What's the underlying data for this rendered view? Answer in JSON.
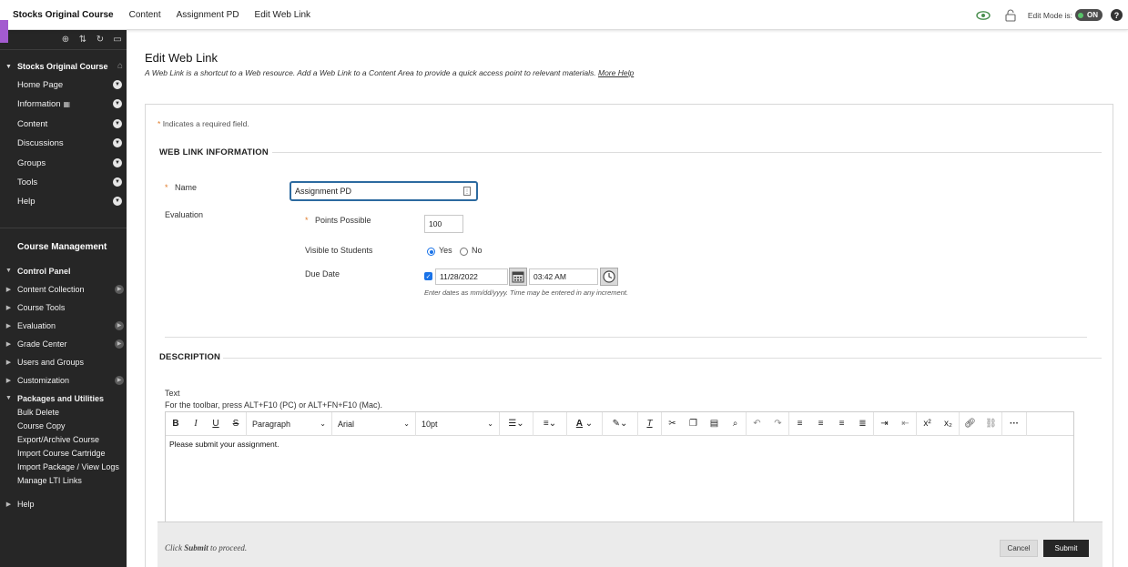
{
  "topbar": {
    "course": "Stocks Original Course",
    "breadcrumbs": [
      "Content",
      "Assignment PD",
      "Edit Web Link"
    ],
    "edit_mode_label": "Edit Mode is:",
    "edit_mode_state": "ON",
    "help": "?"
  },
  "sidebar": {
    "course_title": "Stocks Original Course",
    "items": [
      {
        "label": "Home Page"
      },
      {
        "label": "Information"
      },
      {
        "label": "Content"
      },
      {
        "label": "Discussions"
      },
      {
        "label": "Groups"
      },
      {
        "label": "Tools"
      },
      {
        "label": "Help"
      }
    ],
    "course_management": "Course Management",
    "control_panel": "Control Panel",
    "cp_items": [
      {
        "label": "Content Collection"
      },
      {
        "label": "Course Tools"
      },
      {
        "label": "Evaluation"
      },
      {
        "label": "Grade Center"
      },
      {
        "label": "Users and Groups"
      },
      {
        "label": "Customization"
      }
    ],
    "packages": "Packages and Utilities",
    "packages_items": [
      {
        "label": "Bulk Delete"
      },
      {
        "label": "Course Copy"
      },
      {
        "label": "Export/Archive Course"
      },
      {
        "label": "Import Course Cartridge"
      },
      {
        "label": "Import Package / View Logs"
      },
      {
        "label": "Manage LTI Links"
      }
    ],
    "help": "Help"
  },
  "page": {
    "title": "Edit Web Link",
    "description": "A Web Link is a shortcut to a Web resource. Add a Web Link to a Content Area to provide a quick access point to relevant materials.",
    "more_help": "More Help",
    "required_note": "Indicates a required field."
  },
  "form": {
    "section1": "WEB LINK INFORMATION",
    "name_label": "Name",
    "name_value": "Assignment PD",
    "evaluation_label": "Evaluation",
    "points_label": "Points Possible",
    "points_value": "100",
    "visible_label": "Visible to Students",
    "yes": "Yes",
    "no": "No",
    "due_label": "Due Date",
    "due_date": "11/28/2022",
    "due_time": "03:42 AM",
    "date_hint": "Enter dates as mm/dd/yyyy. Time may be entered in any increment.",
    "section2": "DESCRIPTION",
    "text_label": "Text",
    "toolbar_hint": "For the toolbar, press ALT+F10 (PC) or ALT+FN+F10 (Mac).",
    "editor_format": "Paragraph",
    "editor_font": "Arial",
    "editor_size": "10pt",
    "editor_content": "Please submit your assignment."
  },
  "submit": {
    "note_prefix": "Click ",
    "note_bold": "Submit",
    "note_suffix": " to proceed.",
    "cancel": "Cancel",
    "submit": "Submit"
  }
}
